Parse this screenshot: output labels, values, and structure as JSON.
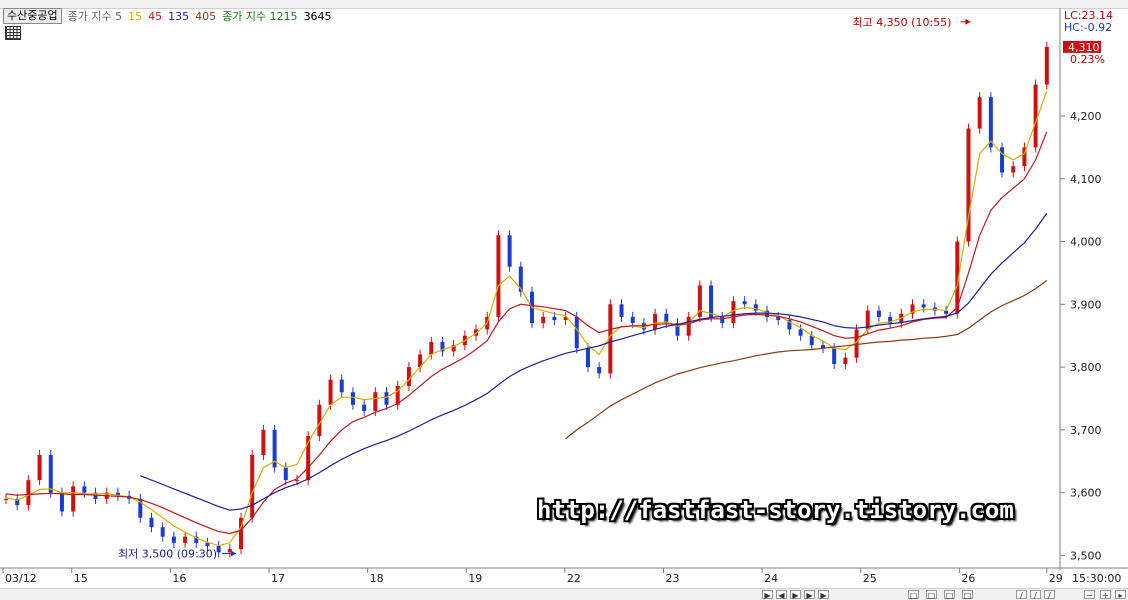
{
  "legend": {
    "stock_name": "수산중공업",
    "price_ma_label": "종가 지수 5",
    "ma_periods": [
      {
        "label": "15",
        "color": "#d4b000"
      },
      {
        "label": "45",
        "color": "#c0191e"
      },
      {
        "label": "135",
        "color": "#1f1f9e"
      },
      {
        "label": "405",
        "color": "#8b3a10"
      }
    ],
    "volume_label": "종가 지수 1215",
    "volume_value": "3645"
  },
  "right_indicators": {
    "lc": "LC:23.14",
    "hc": "HC:-0.92",
    "current_price": "4,310",
    "change_pct": "0.23%"
  },
  "annotations": {
    "high": "최고 4,350 (10:55)",
    "low": "최저 3,500 (09:30)"
  },
  "time_label": "15:30:00",
  "watermark": "http://fastfast-story.tistory.com",
  "colors": {
    "up": "#d01010",
    "down": "#1c3ccf",
    "ma15": "#d4b000",
    "ma45": "#c0191e",
    "ma135": "#1f1f9e",
    "ma405": "#8b3a10",
    "axis": "#7a7a7a"
  },
  "chart_data": {
    "type": "line",
    "title": "",
    "y_tick_labels": [
      "4,200",
      "4,100",
      "4,000",
      "3,900",
      "3,800",
      "3,700",
      "3,600",
      "3,500"
    ],
    "y_ticks": [
      4200,
      4100,
      4000,
      3900,
      3800,
      3700,
      3600,
      3500
    ],
    "ylim": [
      3480,
      4372
    ],
    "x_tick_labels": [
      "03/12",
      "15",
      "16",
      "17",
      "18",
      "19",
      "22",
      "23",
      "24",
      "25",
      "26",
      "29"
    ],
    "high": 4350,
    "low": 3500,
    "last": 4310,
    "series": [
      {
        "name": "price",
        "values": [
          3590,
          3580,
          3620,
          3660,
          3600,
          3570,
          3610,
          3600,
          3590,
          3600,
          3595,
          3590,
          3560,
          3545,
          3530,
          3520,
          3530,
          3520,
          3515,
          3505,
          3510,
          3560,
          3660,
          3700,
          3640,
          3620,
          3620,
          3690,
          3740,
          3780,
          3760,
          3740,
          3730,
          3760,
          3740,
          3770,
          3800,
          3820,
          3840,
          3825,
          3835,
          3850,
          3860,
          3880,
          4010,
          3960,
          3920,
          3870,
          3880,
          3875,
          3880,
          3830,
          3800,
          3790,
          3900,
          3880,
          3870,
          3860,
          3885,
          3870,
          3850,
          3880,
          3930,
          3880,
          3870,
          3905,
          3900,
          3890,
          3880,
          3875,
          3860,
          3850,
          3835,
          3830,
          3805,
          3815,
          3860,
          3890,
          3880,
          3870,
          3885,
          3900,
          3895,
          3890,
          3885,
          4000,
          4180,
          4230,
          4150,
          4110,
          4120,
          4150,
          4250,
          4310
        ]
      },
      {
        "name": "MA15",
        "values": [
          3592,
          3588,
          3596,
          3605,
          3606,
          3600,
          3600,
          3598,
          3598,
          3598,
          3596,
          3593,
          3585,
          3573,
          3560,
          3547,
          3537,
          3528,
          3521,
          3516,
          3520,
          3545,
          3600,
          3640,
          3650,
          3640,
          3645,
          3680,
          3710,
          3740,
          3752,
          3752,
          3748,
          3750,
          3752,
          3762,
          3780,
          3800,
          3820,
          3828,
          3833,
          3842,
          3854,
          3870,
          3930,
          3945,
          3925,
          3895,
          3890,
          3885,
          3882,
          3860,
          3835,
          3820,
          3850,
          3865,
          3865,
          3863,
          3870,
          3872,
          3865,
          3870,
          3890,
          3885,
          3880,
          3890,
          3895,
          3893,
          3887,
          3882,
          3872,
          3863,
          3850,
          3842,
          3830,
          3828,
          3840,
          3860,
          3870,
          3872,
          3878,
          3888,
          3892,
          3892,
          3890,
          3930,
          4040,
          4140,
          4160,
          4140,
          4130,
          4140,
          4190,
          4240
        ]
      },
      {
        "name": "MA45",
        "values": [
          3598,
          3596,
          3597,
          3598,
          3599,
          3598,
          3597,
          3597,
          3596,
          3595,
          3594,
          3593,
          3589,
          3583,
          3576,
          3568,
          3560,
          3552,
          3545,
          3538,
          3535,
          3540,
          3560,
          3585,
          3605,
          3615,
          3622,
          3640,
          3660,
          3682,
          3700,
          3713,
          3720,
          3728,
          3734,
          3742,
          3755,
          3770,
          3785,
          3797,
          3806,
          3816,
          3828,
          3842,
          3872,
          3893,
          3900,
          3898,
          3896,
          3893,
          3890,
          3880,
          3866,
          3855,
          3860,
          3864,
          3866,
          3866,
          3868,
          3869,
          3868,
          3869,
          3875,
          3877,
          3877,
          3880,
          3883,
          3884,
          3883,
          3881,
          3877,
          3872,
          3865,
          3858,
          3850,
          3846,
          3847,
          3853,
          3859,
          3862,
          3866,
          3872,
          3876,
          3878,
          3879,
          3895,
          3950,
          4010,
          4050,
          4070,
          4085,
          4100,
          4130,
          4175
        ]
      },
      {
        "name": "MA135",
        "values": [
          null,
          null,
          null,
          null,
          null,
          null,
          null,
          null,
          null,
          null,
          null,
          null,
          3627,
          3620,
          3613,
          3606,
          3599,
          3592,
          3585,
          3578,
          3572,
          3574,
          3580,
          3590,
          3600,
          3608,
          3614,
          3622,
          3632,
          3643,
          3653,
          3662,
          3670,
          3677,
          3683,
          3690,
          3698,
          3707,
          3716,
          3724,
          3731,
          3739,
          3748,
          3758,
          3772,
          3785,
          3795,
          3803,
          3810,
          3816,
          3822,
          3826,
          3830,
          3834,
          3840,
          3845,
          3850,
          3855,
          3860,
          3865,
          3868,
          3872,
          3876,
          3879,
          3881,
          3883,
          3885,
          3886,
          3886,
          3885,
          3883,
          3880,
          3876,
          3872,
          3866,
          3863,
          3862,
          3864,
          3867,
          3869,
          3871,
          3874,
          3877,
          3879,
          3881,
          3886,
          3902,
          3925,
          3948,
          3966,
          3982,
          3998,
          4020,
          4045
        ]
      },
      {
        "name": "MA405",
        "values": [
          null,
          null,
          null,
          null,
          null,
          null,
          null,
          null,
          null,
          null,
          null,
          null,
          null,
          null,
          null,
          null,
          null,
          null,
          null,
          null,
          null,
          null,
          null,
          null,
          null,
          null,
          null,
          null,
          null,
          null,
          null,
          null,
          null,
          null,
          null,
          null,
          null,
          null,
          null,
          null,
          null,
          null,
          null,
          null,
          null,
          null,
          null,
          null,
          null,
          null,
          3686,
          3700,
          3712,
          3725,
          3738,
          3748,
          3757,
          3766,
          3775,
          3782,
          3789,
          3794,
          3799,
          3803,
          3807,
          3810,
          3814,
          3818,
          3821,
          3824,
          3826,
          3827,
          3828,
          3830,
          3832,
          3834,
          3836,
          3838,
          3840,
          3841,
          3843,
          3844,
          3846,
          3847,
          3849,
          3852,
          3862,
          3875,
          3888,
          3898,
          3906,
          3914,
          3925,
          3938
        ]
      }
    ]
  }
}
